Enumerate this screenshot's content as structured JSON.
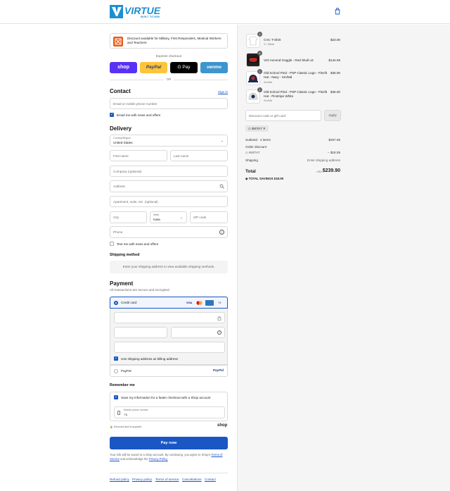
{
  "header": {
    "brand": "VIRTUE",
    "tagline": "BUILT TO WIN"
  },
  "banner": {
    "text": "Discount available for Military, First Responders, Medical Workers and Teachers"
  },
  "express": {
    "title": "Express checkout",
    "shop": "shop",
    "paypal": "PayPal",
    "gpay": "G Pay",
    "venmo": "venmo",
    "or": "OR"
  },
  "contact": {
    "heading": "Contact",
    "signin": "Sign in",
    "email_placeholder": "Email or mobile phone number",
    "news": "Email me with news and offers"
  },
  "delivery": {
    "heading": "Delivery",
    "country_label": "Country/Region",
    "country_value": "United States",
    "first_name": "First name",
    "last_name": "Last name",
    "company": "Company (optional)",
    "address": "Address",
    "apartment": "Apartment, suite, etc. (optional)",
    "city": "City",
    "state_label": "State",
    "state_value": "Iowa",
    "zip": "ZIP code",
    "phone": "Phone",
    "text_news": "Text me with news and offers"
  },
  "shipping": {
    "heading": "Shipping method",
    "note": "Enter your shipping address to view available shipping methods."
  },
  "payment": {
    "heading": "Payment",
    "sub": "All transactions are secure and encrypted.",
    "credit_card": "Credit card",
    "cards": [
      "VISA",
      "MC",
      "AMEX"
    ],
    "more": "+3",
    "billing_same": "Use shipping address as billing address",
    "paypal": "PayPal"
  },
  "remember": {
    "heading": "Remember me",
    "save": "Save my information for a faster checkout with a Shop account",
    "mobile_label": "Mobile phone number",
    "mobile_value": "+1",
    "secure": "Secured and encrypted",
    "shop": "shop"
  },
  "pay": {
    "button": "Pay now",
    "legal_1": "Your info will be saved to a Shop account. By continuing, you agree to Shop's",
    "terms": "Terms of Service",
    "legal_2": "and acknowledge the",
    "privacy": "Privacy Policy."
  },
  "footer": [
    "Refund policy",
    "Privacy policy",
    "Terms of service",
    "Cancellations",
    "Contact"
  ],
  "cart": {
    "items": [
      {
        "name": "CVC T-Shirt",
        "variant": "S / White",
        "price": "$23.00",
        "qty": "1"
      },
      {
        "name": "VIO Ascend Goggle - Red Skull LE",
        "variant": "",
        "price": "$144.95",
        "qty": "1"
      },
      {
        "name": "Old School Pind - PSP Classic Logo - Flexfit Hat - Navy - Sm/Md",
        "variant": "Sm/Md",
        "price": "$45.00",
        "qty": "1"
      },
      {
        "name": "Old School Pind - PSP Classic Logo - Flexfit Hat - Pinstripe White",
        "variant": "Sm/Md",
        "price": "$45.00",
        "qty": "1"
      }
    ],
    "discount_placeholder": "Discount code or gift card",
    "apply": "Apply",
    "code": "INSTA7",
    "subtotal_label": "Subtotal · 4 items",
    "subtotal": "$257.95",
    "order_discount": "Order discount",
    "code_line": "INSTA7",
    "discount_value": "− $18.05",
    "shipping_label": "Shipping",
    "shipping_value": "Enter shipping address",
    "total_label": "Total",
    "currency": "USD",
    "total": "$239.90",
    "savings_label": "TOTAL SAVINGS",
    "savings": "$18.05"
  },
  "colors": {
    "accent": "#1a56c4",
    "shop": "#5a31f4",
    "paypal": "#ffc439",
    "venmo": "#3d95ce",
    "brand": "#1d8fd0"
  }
}
